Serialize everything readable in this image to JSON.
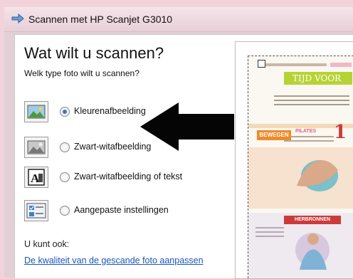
{
  "window": {
    "title": "Scannen met HP Scanjet G3010"
  },
  "dialog": {
    "heading": "Wat wilt u scannen?",
    "subheading": "Welk type foto wilt u scannen?",
    "options": [
      {
        "label": "Kleurenafbeelding",
        "selected": true,
        "icon": "color-photo-icon"
      },
      {
        "label": "Zwart-witafbeelding",
        "selected": false,
        "icon": "grayscale-photo-icon"
      },
      {
        "label": "Zwart-witafbeelding of tekst",
        "selected": false,
        "icon": "bw-text-icon"
      },
      {
        "label": "Aangepaste instellingen",
        "selected": false,
        "icon": "custom-settings-icon"
      }
    ],
    "also_label": "U kunt ook:",
    "quality_link": "De kwaliteit van de gescande foto aanpassen"
  },
  "preview": {
    "magazine": {
      "headline": "TIJD VOOR",
      "section1": "BEWEGEN",
      "section1_tag": "PILATES",
      "section1_number": "1",
      "section2": "HERBRONNEN"
    }
  },
  "colors": {
    "accent": "#3a72c8",
    "link": "#1a56b8",
    "headline_green": "#b5d334",
    "section_orange": "#f08a2a",
    "section_red": "#cc3b3b"
  }
}
